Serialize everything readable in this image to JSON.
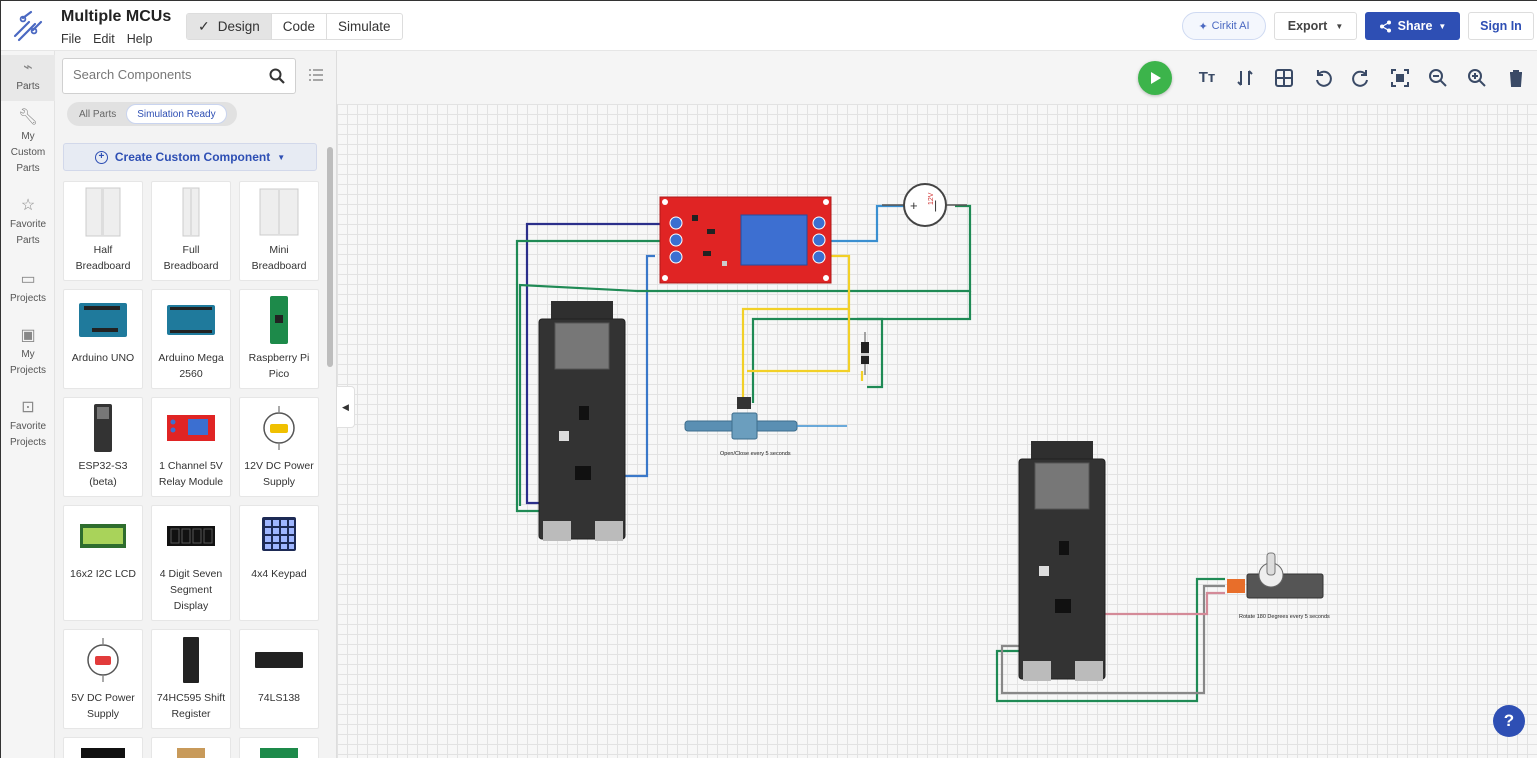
{
  "header": {
    "project_title": "Multiple MCUs",
    "menus": [
      "File",
      "Edit",
      "Help"
    ],
    "modes": [
      {
        "label": "Design",
        "active": true
      },
      {
        "label": "Code",
        "active": false
      },
      {
        "label": "Simulate",
        "active": false
      }
    ],
    "ai_label": "Cirkit AI",
    "export_label": "Export",
    "share_label": "Share",
    "signin_label": "Sign In"
  },
  "rail": {
    "items": [
      {
        "label": "Parts",
        "icon": "parts-icon"
      },
      {
        "label": "My Custom Parts",
        "icon": "wrench-icon"
      },
      {
        "label": "Favorite Parts",
        "icon": "star-icon"
      },
      {
        "label": "Projects",
        "icon": "folder-icon"
      },
      {
        "label": "My Projects",
        "icon": "user-folder-icon"
      },
      {
        "label": "Favorite Projects",
        "icon": "star-folder-icon"
      }
    ]
  },
  "panel": {
    "search_placeholder": "Search Components",
    "filters": [
      {
        "label": "All Parts",
        "active": false
      },
      {
        "label": "Simulation Ready",
        "active": true
      }
    ],
    "create_label": "Create Custom Component",
    "parts": [
      {
        "label": "Half Breadboard"
      },
      {
        "label": "Full Breadboard"
      },
      {
        "label": "Mini Breadboard"
      },
      {
        "label": "Arduino UNO"
      },
      {
        "label": "Arduino Mega 2560"
      },
      {
        "label": "Raspberry Pi Pico"
      },
      {
        "label": "ESP32-S3 (beta)"
      },
      {
        "label": "1 Channel 5V Relay Module"
      },
      {
        "label": "12V DC Power Supply"
      },
      {
        "label": "16x2 I2C LCD"
      },
      {
        "label": "4 Digit Seven Segment Display"
      },
      {
        "label": "4x4 Keypad"
      },
      {
        "label": "5V DC Power Supply"
      },
      {
        "label": "74HC595 Shift Register"
      },
      {
        "label": "74LS138"
      }
    ]
  },
  "canvas": {
    "tools": [
      "text-tool-icon",
      "flip-icon",
      "grid-icon",
      "rotate-left-icon",
      "rotate-right-icon",
      "fit-screen-icon",
      "zoom-out-icon",
      "zoom-in-icon",
      "delete-icon"
    ],
    "valve_caption": "Open/Close every 5 seconds",
    "servo_caption": "Rotate 180 Degrees every 5 seconds",
    "supply_label": "12V",
    "colors": {
      "run": "#3cb44b",
      "brand": "#2e4fb4",
      "relay": "#e02424"
    }
  }
}
